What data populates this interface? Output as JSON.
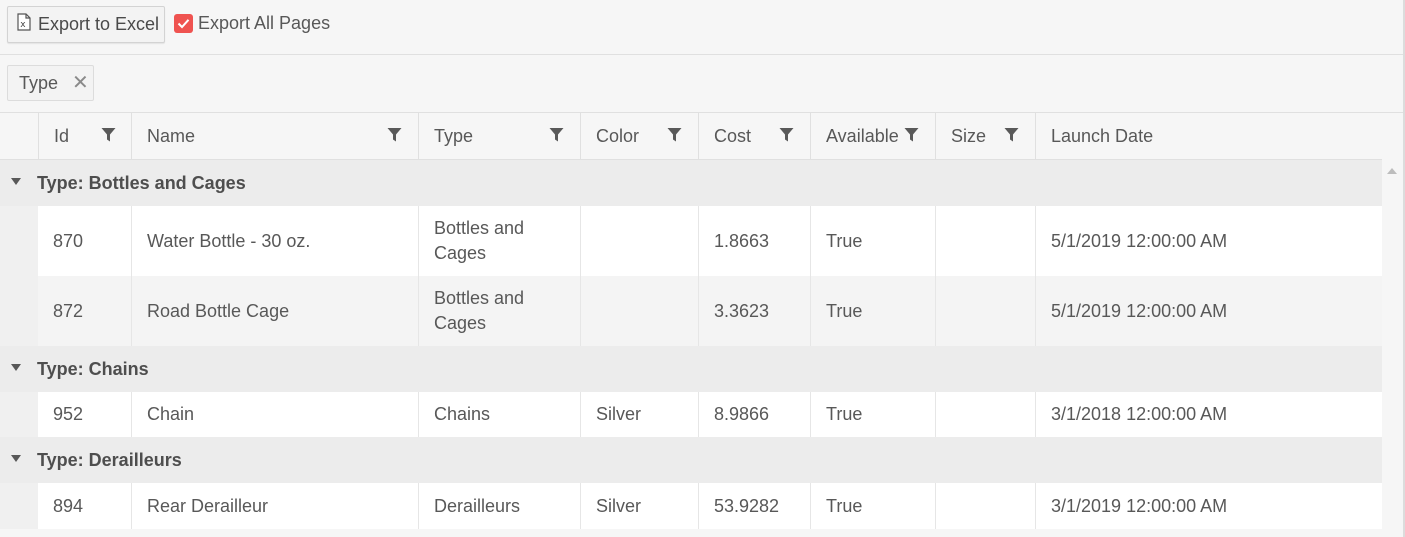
{
  "toolbar": {
    "export_label": "Export to Excel",
    "export_icon": "excel-file-icon",
    "export_all_label": "Export All Pages",
    "export_all_checked": true,
    "accent_color": "#ef5350"
  },
  "group_panel": {
    "chip_label": "Type",
    "remove_icon": "close-icon"
  },
  "columns": [
    {
      "label": "Id"
    },
    {
      "label": "Name"
    },
    {
      "label": "Type"
    },
    {
      "label": "Color"
    },
    {
      "label": "Cost"
    },
    {
      "label": "Available"
    },
    {
      "label": "Size"
    },
    {
      "label": "Launch Date"
    }
  ],
  "groups": [
    {
      "label": "Type: Bottles and Cages",
      "rows": [
        {
          "id": "870",
          "name": "Water Bottle - 30 oz.",
          "type": "Bottles and Cages",
          "color": "",
          "cost": "1.8663",
          "available": "True",
          "size": "",
          "launch_date": "5/1/2019 12:00:00 AM"
        },
        {
          "id": "872",
          "name": "Road Bottle Cage",
          "type": "Bottles and Cages",
          "color": "",
          "cost": "3.3623",
          "available": "True",
          "size": "",
          "launch_date": "5/1/2019 12:00:00 AM"
        }
      ]
    },
    {
      "label": "Type: Chains",
      "rows": [
        {
          "id": "952",
          "name": "Chain",
          "type": "Chains",
          "color": "Silver",
          "cost": "8.9866",
          "available": "True",
          "size": "",
          "launch_date": "3/1/2018 12:00:00 AM"
        }
      ]
    },
    {
      "label": "Type: Derailleurs",
      "rows": [
        {
          "id": "894",
          "name": "Rear Derailleur",
          "type": "Derailleurs",
          "color": "Silver",
          "cost": "53.9282",
          "available": "True",
          "size": "",
          "launch_date": "3/1/2019 12:00:00 AM"
        }
      ]
    }
  ]
}
